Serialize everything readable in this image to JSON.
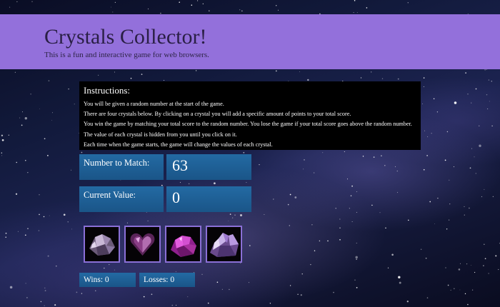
{
  "header": {
    "title": "Crystals Collector!",
    "subtitle": "This is a fun and interactive game for web browsers."
  },
  "instructions": {
    "title": "Instructions:",
    "lines": [
      "You will be given a random number at the start of the game.",
      "There are four crystals below. By clicking on a crystal you will add a specific amount of points to your total score.",
      "You win the game by matching your total score to the random number. You lose the game if your total score goes above the random number.",
      "The value of each crystal is hidden from you until you click on it.",
      "Each time when the game starts, the game will change the values of each crystal."
    ]
  },
  "target": {
    "label": "Number to Match:",
    "value": "63"
  },
  "current": {
    "label": "Current Value:",
    "value": "0"
  },
  "crystals": [
    {
      "icon": "crystal-cluster-icon",
      "color": "#b9a4c9"
    },
    {
      "icon": "heart-crystal-icon",
      "color": "#8a3d86"
    },
    {
      "icon": "pink-crystal-icon",
      "color": "#d34fd1"
    },
    {
      "icon": "amethyst-crystal-icon",
      "color": "#9f7ad0"
    }
  ],
  "stats": {
    "wins_text": "Wins: 0",
    "losses_text": "Losses: 0"
  },
  "colors": {
    "header_bg": "#9370db",
    "panel_bg": "#1d5f95",
    "instructions_bg": "#000000"
  }
}
